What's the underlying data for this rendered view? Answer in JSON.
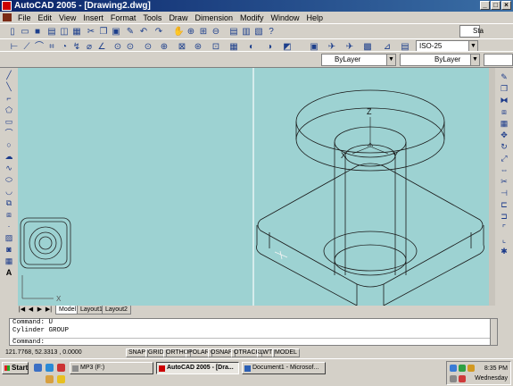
{
  "window": {
    "title": "AutoCAD 2005 - [Drawing2.dwg]"
  },
  "menu": [
    "File",
    "Edit",
    "View",
    "Insert",
    "Format",
    "Tools",
    "Draw",
    "Dimension",
    "Modify",
    "Window",
    "Help"
  ],
  "toolbars": {
    "std_style_combo": "Sta",
    "dim_style_combo": "ISO-25",
    "layer_combo": "ByLayer",
    "linetype_combo": "ByLayer"
  },
  "viewport": {
    "background": "#9dd2d2",
    "axis_labels": {
      "z": "Z",
      "x": "X",
      "y": "Y"
    },
    "ucs_labels": {
      "x": "X",
      "y": "Y"
    }
  },
  "tabs": [
    "Model",
    "Layout1",
    "Layout2"
  ],
  "command": {
    "lines": [
      "Command: U",
      "Cylinder GROUP"
    ],
    "prompt": "Command:"
  },
  "status": {
    "coords": "121.7768, 52.3313 , 0.0000",
    "buttons": [
      "SNAP",
      "GRID",
      "ORTHO",
      "POLAR",
      "OSNAP",
      "OTRACK",
      "LWT",
      "MODEL"
    ]
  },
  "taskbar": {
    "start": "Start",
    "tasks": [
      "MP3 (F:)",
      "AutoCAD 2005 - [Dra...",
      "Document1 - Microsof..."
    ],
    "clock": "8:35 PM",
    "day": "Wednesday"
  }
}
